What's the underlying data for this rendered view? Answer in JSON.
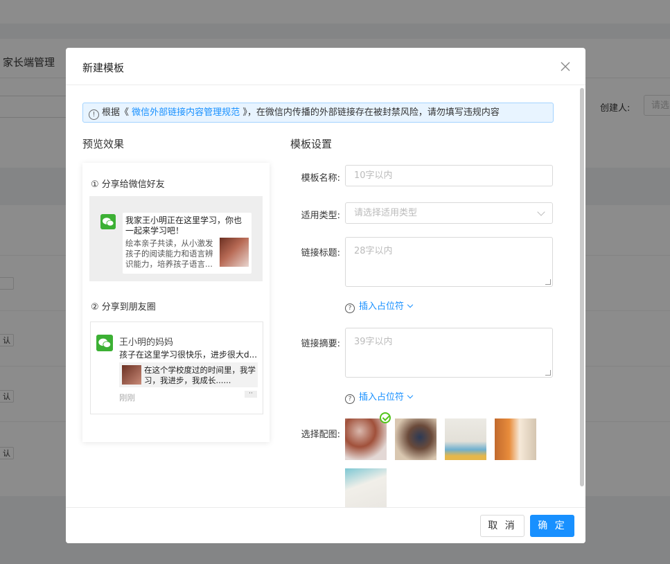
{
  "background": {
    "page_title": "家长端管理",
    "creator_label": "创建人:",
    "creator_placeholder": "请选",
    "row_button_label": "认"
  },
  "modal": {
    "title": "新建模板",
    "notice": {
      "prefix": "根据《",
      "link": "微信外部链接内容管理规范",
      "suffix": "》，在微信内传播的外部链接存在被封禁风险，请勿填写违规内容"
    },
    "preview": {
      "heading": "预览效果",
      "share_friend_label": "① 分享给微信好友",
      "friend_card": {
        "title": "我家王小明正在这里学习，你也一起来学习吧！",
        "desc": "绘本亲子共读，从小激发孩子的阅读能力和语言辨识能力，培养孩子语言..."
      },
      "share_moments_label": "② 分享到朋友圈",
      "moments_card": {
        "name": "王小明的妈妈",
        "text": "孩子在这里学习很快乐，进步很大d...",
        "link_text": "在这个学校度过的时间里，我学习，我进步，我成长......",
        "time": "刚刚",
        "more": "··"
      }
    },
    "settings": {
      "heading": "模板设置",
      "name_label": "模板名称:",
      "name_placeholder": "10字以内",
      "type_label": "适用类型:",
      "type_placeholder": "请选择适用类型",
      "link_title_label": "链接标题:",
      "link_title_placeholder": "28字以内",
      "insert_placeholder_1": "插入占位符",
      "link_summary_label": "链接摘要:",
      "link_summary_placeholder": "39字以内",
      "insert_placeholder_2": "插入占位符",
      "image_label": "选择配图:",
      "selected_image_index": 0
    },
    "footer": {
      "cancel": "取 消",
      "ok": "确 定"
    },
    "colors": {
      "primary": "#1890ff",
      "success": "#52c41a",
      "wechat_green": "#3cb034"
    }
  }
}
